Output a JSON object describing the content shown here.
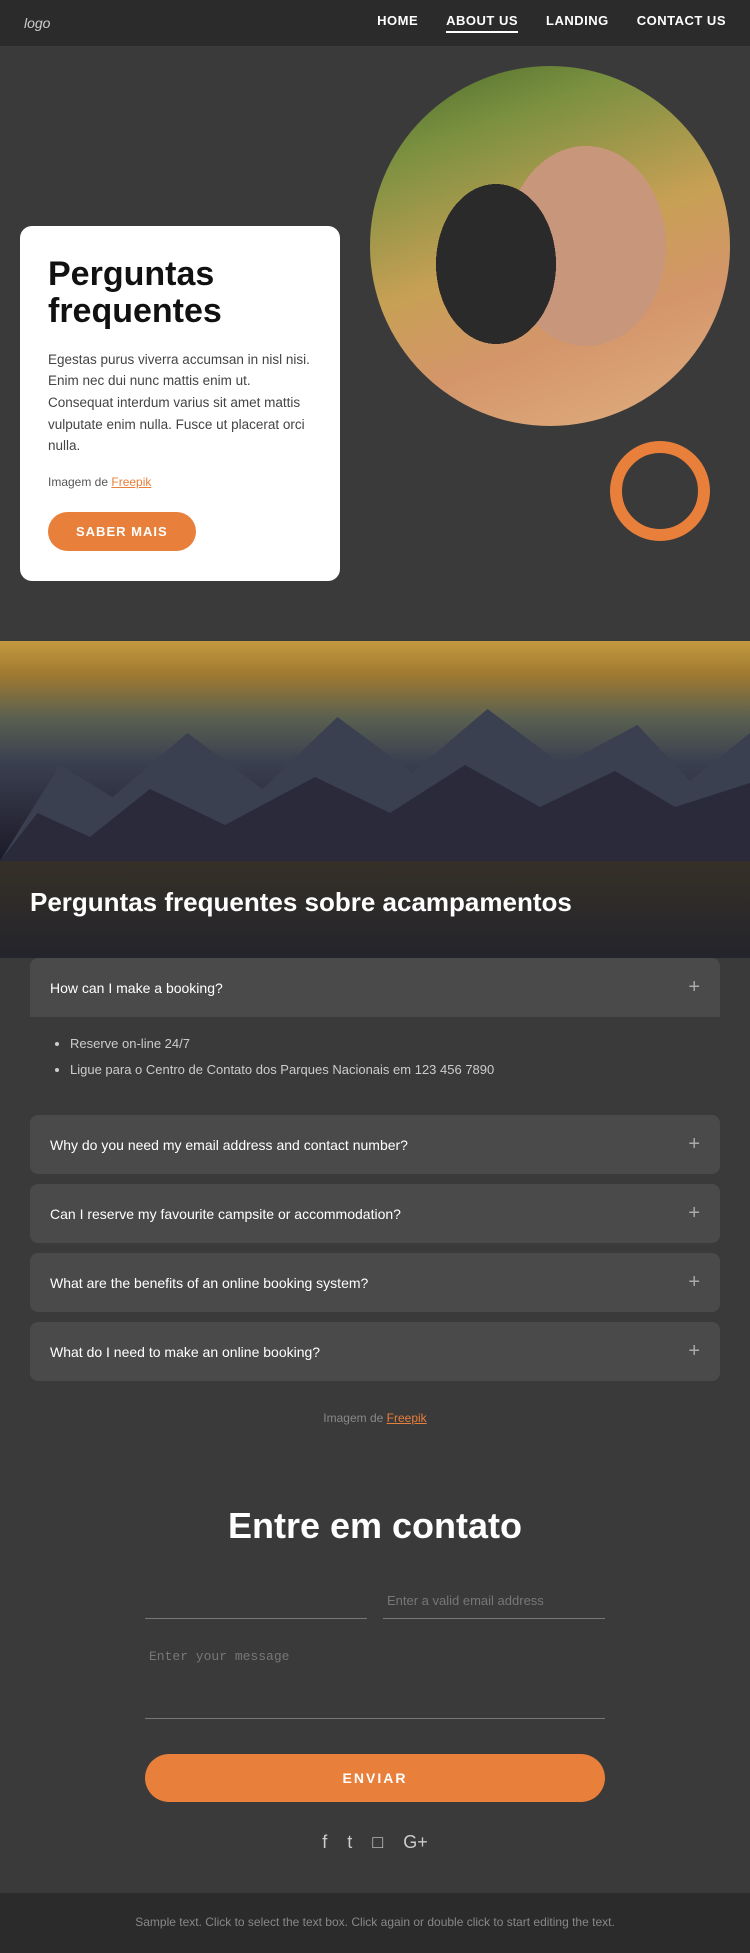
{
  "nav": {
    "logo": "logo",
    "links": [
      {
        "label": "HOME",
        "active": false
      },
      {
        "label": "ABOUT US",
        "active": true
      },
      {
        "label": "LANDING",
        "active": false
      },
      {
        "label": "CONTACT US",
        "active": false
      }
    ]
  },
  "hero": {
    "title": "Perguntas frequentes",
    "description": "Egestas purus viverra accumsan in nisl nisi. Enim nec dui nunc mattis enim ut. Consequat interdum varius sit amet mattis vulputate enim nulla. Fusce ut placerat orci nulla.",
    "image_credit_text": "Imagem de ",
    "image_credit_link": "Freepik",
    "button_label": "SABER MAIS"
  },
  "faq_banner": {
    "title": "Perguntas frequentes sobre acampamentos"
  },
  "faq_items": [
    {
      "question": "How can I make a booking?",
      "open": true,
      "answer_items": [
        "Reserve on-line 24/7",
        "Ligue para o Centro de Contato dos Parques Nacionais em 123 456 7890"
      ]
    },
    {
      "question": "Why do you need my email address and contact number?",
      "open": false,
      "answer_items": []
    },
    {
      "question": "Can I reserve my favourite campsite or accommodation?",
      "open": false,
      "answer_items": []
    },
    {
      "question": "What are the benefits of an online booking system?",
      "open": false,
      "answer_items": []
    },
    {
      "question": "What do I need to make an online booking?",
      "open": false,
      "answer_items": []
    }
  ],
  "faq_image_credit_text": "Imagem de ",
  "faq_image_credit_link": "Freepik",
  "contact": {
    "title": "Entre em contato",
    "name_placeholder": "",
    "email_placeholder": "Enter a valid email address",
    "message_placeholder": "Enter your message",
    "button_label": "ENVIAR"
  },
  "social": {
    "icons": [
      "f",
      "t",
      "ig",
      "g+"
    ]
  },
  "footer": {
    "text": "Sample text. Click to select the text box. Click again or double click to start editing the text."
  },
  "colors": {
    "orange": "#e87f3a",
    "dark_bg": "#3a3a3a",
    "darker_bg": "#2b2b2b",
    "card_bg": "#ffffff"
  }
}
